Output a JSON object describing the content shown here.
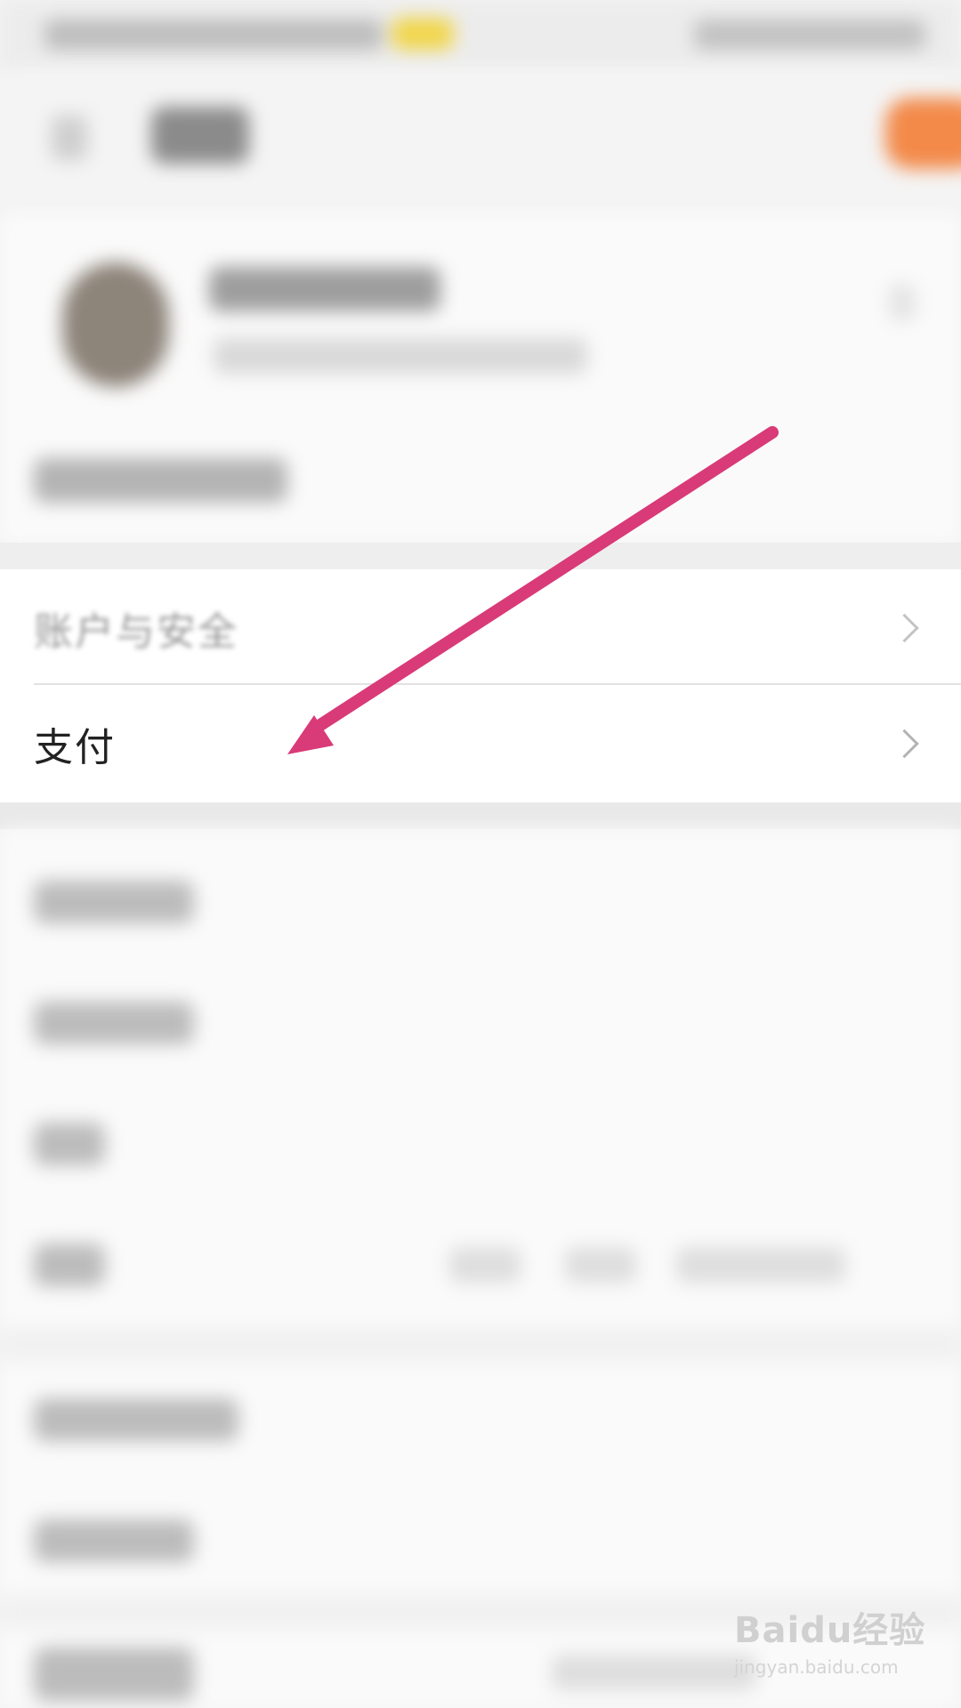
{
  "settings": {
    "items": [
      {
        "label": "账户与安全"
      },
      {
        "label": "支付"
      }
    ]
  },
  "annotation": {
    "color": "#d93a78"
  },
  "watermark": {
    "main": "Baidu经验",
    "sub": "jingyan.baidu.com"
  }
}
